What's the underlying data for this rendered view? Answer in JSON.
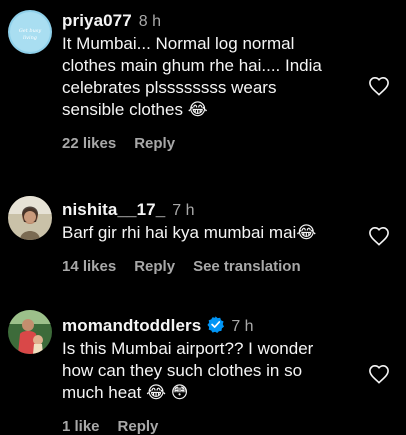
{
  "comments": [
    {
      "username": "priya077",
      "time": "8 h",
      "text": "It Mumbai... Normal log normal\nclothes main ghum rhe hai.... India\ncelebrates plssssssss wears\nsensible clothes",
      "emoji_after_text": "😂",
      "likes": "22 likes",
      "reply": "Reply",
      "avatar_text": "Get busy living"
    },
    {
      "username": "nishita__17_",
      "time": "7 h",
      "text": "Barf gir rhi hai kya mumbai mai",
      "emoji_after_text": "😂",
      "likes": "14 likes",
      "reply": "Reply",
      "see_translation": "See translation"
    },
    {
      "username": "momandtoddlers",
      "verified": true,
      "time": "7 h",
      "text": "Is this Mumbai airport?? I wonder\nhow can they such clothes in so\nmuch heat",
      "emoji_after_text": "😂 😳",
      "likes": "1 like",
      "reply": "Reply"
    }
  ],
  "colors": {
    "background": "#000000",
    "text": "#f5f5f5",
    "muted": "#a8a8a8",
    "verified": "#0095f6"
  }
}
